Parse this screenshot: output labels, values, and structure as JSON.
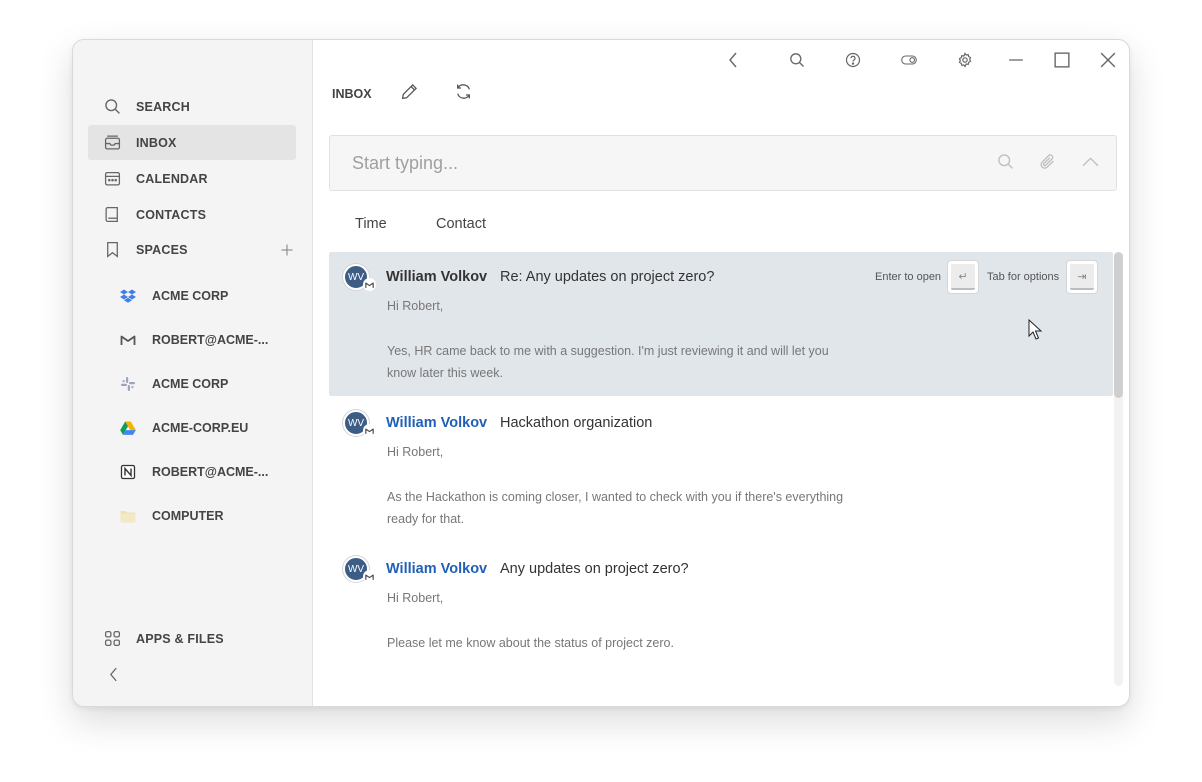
{
  "sidebar": {
    "nav": [
      {
        "label": "SEARCH",
        "icon": "search-icon"
      },
      {
        "label": "INBOX",
        "icon": "inbox-icon",
        "active": true
      },
      {
        "label": "CALENDAR",
        "icon": "calendar-icon"
      },
      {
        "label": "CONTACTS",
        "icon": "contacts-icon"
      },
      {
        "label": "SPACES",
        "icon": "bookmark-icon"
      }
    ],
    "spaces": [
      {
        "label": "ACME CORP",
        "icon": "dropbox-icon"
      },
      {
        "label": "ROBERT@ACME-...",
        "icon": "gmail-icon"
      },
      {
        "label": "ACME CORP",
        "icon": "slack-icon"
      },
      {
        "label": "ACME-CORP.EU",
        "icon": "google-drive-icon"
      },
      {
        "label": "ROBERT@ACME-...",
        "icon": "notion-icon"
      },
      {
        "label": "COMPUTER",
        "icon": "folder-icon"
      }
    ],
    "apps_files": "APPS & FILES"
  },
  "header": {
    "title": "INBOX"
  },
  "search": {
    "placeholder": "Start typing..."
  },
  "sort_tabs": [
    "Time",
    "Contact"
  ],
  "hints": {
    "enter": "Enter to open",
    "enter_key": "↵",
    "tab": "Tab for options",
    "tab_key": "⇥"
  },
  "emails": [
    {
      "initials": "WV",
      "sender": "William Volkov",
      "subject": "Re: Any updates on project zero?",
      "greeting": "Hi Robert,",
      "body": "Yes, HR came back to me with a suggestion. I'm just reviewing it and will let you know later this week."
    },
    {
      "initials": "WV",
      "sender": "William Volkov",
      "subject": "Hackathon organization",
      "greeting": "Hi Robert,",
      "body": "As the Hackathon is coming closer, I wanted to check with you if there's everything ready for that."
    },
    {
      "initials": "WV",
      "sender": "William Volkov",
      "subject": "Any updates on project zero?",
      "greeting": "Hi Robert,",
      "body": "Please let me know about the status of project zero."
    }
  ],
  "colors": {
    "selected_row": "#e1e6eb",
    "sender_link": "#1f5fb8",
    "avatar": "#3d5d86"
  }
}
